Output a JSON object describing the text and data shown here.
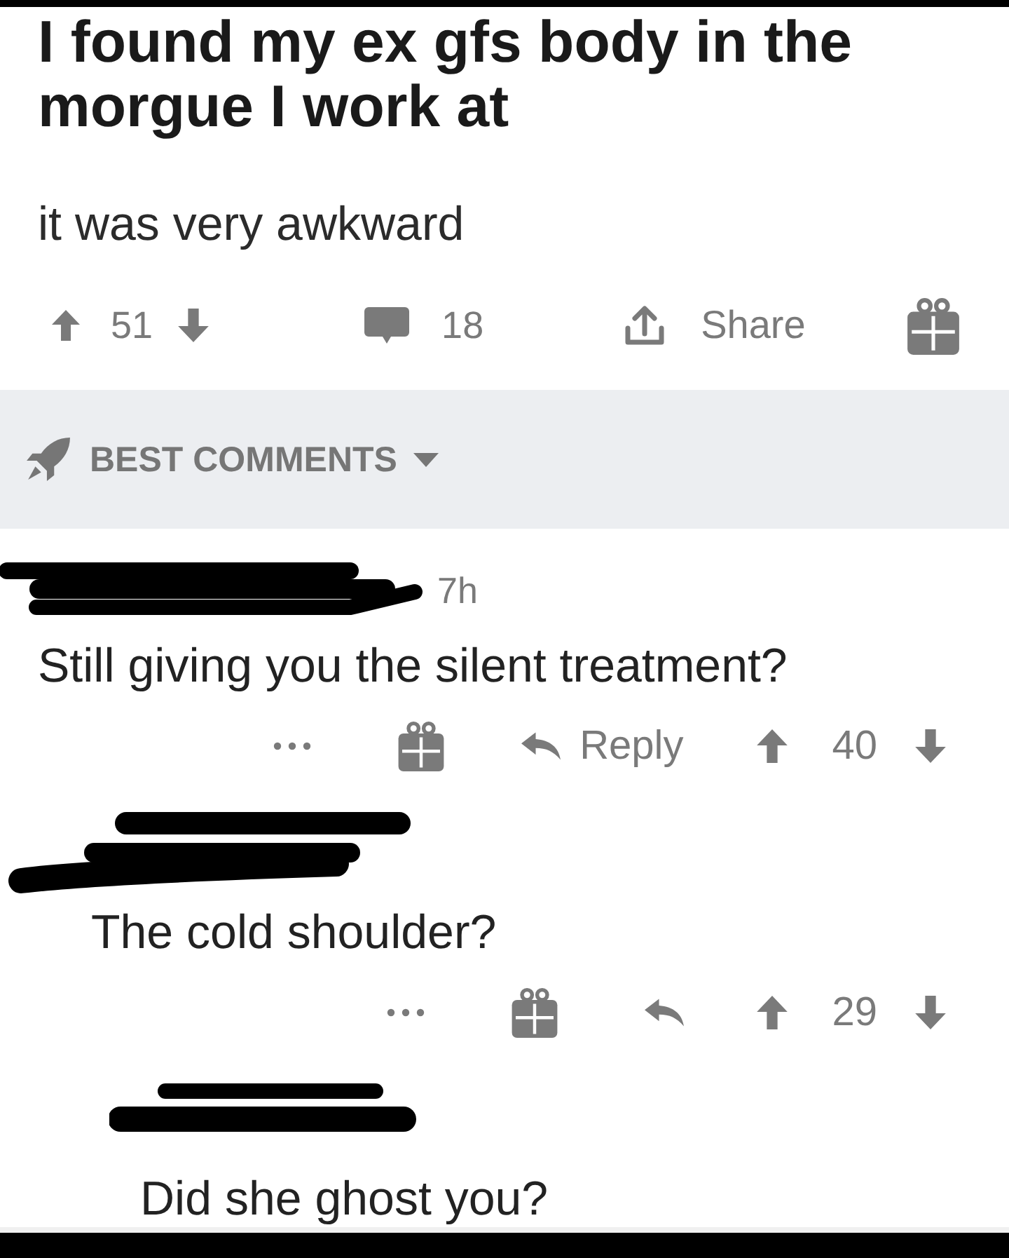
{
  "post": {
    "title": "I found my ex gfs body in the morgue I work at",
    "body": "it was very awkward",
    "score": "51",
    "comment_count": "18",
    "share_label": "Share"
  },
  "comment_sort": {
    "label": "BEST COMMENTS"
  },
  "comments": [
    {
      "age": "7h",
      "text": "Still giving you the silent treatment?",
      "actions": {
        "reply_label": "Reply",
        "score": "40"
      },
      "children": [
        {
          "text": "The cold shoulder?",
          "actions": {
            "score": "29"
          },
          "children": [
            {
              "text": "Did she ghost you?"
            }
          ]
        }
      ]
    }
  ]
}
